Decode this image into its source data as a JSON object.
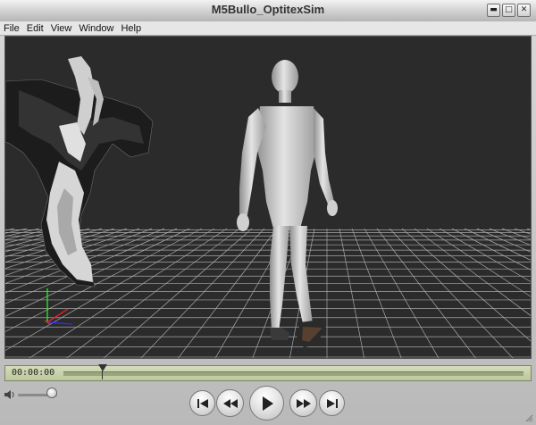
{
  "window": {
    "title": "M5Bullo_OptitexSim"
  },
  "window_controls": {
    "minimize": "▬",
    "maximize": "□",
    "close": "✕"
  },
  "menu": {
    "items": [
      "File",
      "Edit",
      "View",
      "Window",
      "Help"
    ]
  },
  "viewport": {
    "background": "#2b2b2b",
    "grid_color": "#c8c8c8",
    "axis_colors": {
      "x": "#ff2020",
      "y": "#20ff20",
      "z": "#3030ff"
    }
  },
  "timeline": {
    "time": "00:00:00",
    "position_fraction": 0.06
  },
  "volume": {
    "level_fraction": 0.8
  },
  "transport": {
    "buttons": [
      {
        "name": "skip-to-start-button",
        "icon": "skip-back-icon"
      },
      {
        "name": "rewind-button",
        "icon": "rewind-icon"
      },
      {
        "name": "play-button",
        "icon": "play-icon"
      },
      {
        "name": "fast-forward-button",
        "icon": "fast-forward-icon"
      },
      {
        "name": "skip-to-end-button",
        "icon": "skip-forward-icon"
      }
    ]
  }
}
